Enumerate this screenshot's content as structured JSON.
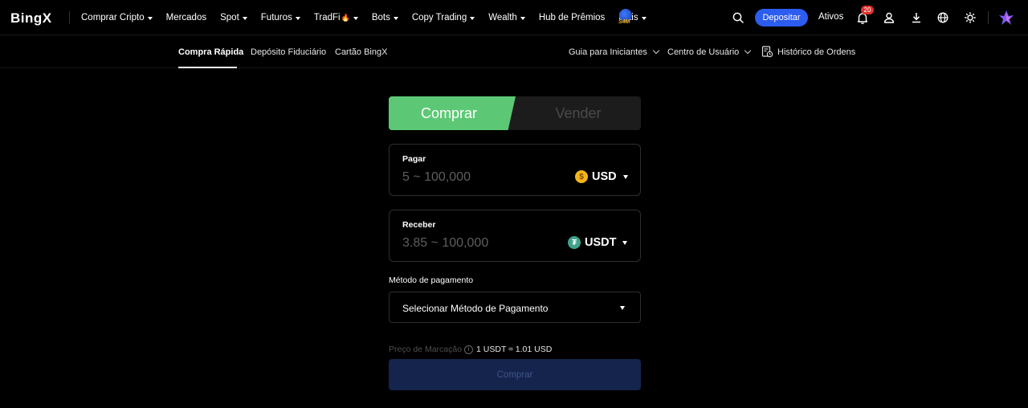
{
  "brand": {
    "logo_text": "BingX"
  },
  "nav": {
    "items": [
      {
        "label": "Comprar Cripto",
        "dropdown": true
      },
      {
        "label": "Mercados",
        "dropdown": false
      },
      {
        "label": "Spot",
        "dropdown": true
      },
      {
        "label": "Futuros",
        "dropdown": true
      },
      {
        "label": "TradFi",
        "dropdown": true,
        "emoji": "🔥"
      },
      {
        "label": "Bots",
        "dropdown": true
      },
      {
        "label": "Copy Trading",
        "dropdown": true
      },
      {
        "label": "Wealth",
        "dropdown": true
      },
      {
        "label": "Hub de Prêmios",
        "dropdown": false
      },
      {
        "label": "Mais",
        "dropdown": true
      }
    ],
    "promo_text": "S4M",
    "deposit_label": "Depositar",
    "assets_label": "Ativos",
    "notification_count": "20",
    "icons": [
      "search-icon",
      "bell-icon",
      "user-icon",
      "download-icon",
      "globe-icon",
      "sun-icon",
      "avatar"
    ]
  },
  "subnav": {
    "tabs": [
      {
        "label": "Compra Rápida",
        "active": true
      },
      {
        "label": "Depósito Fiduciário",
        "active": false
      },
      {
        "label": "Cartão BingX",
        "active": false
      }
    ],
    "guide_label": "Guia para Iniciantes",
    "user_center_label": "Centro de Usuário",
    "order_history_label": "Histórico de Ordens"
  },
  "trade": {
    "buy_label": "Comprar",
    "sell_label": "Vender",
    "pay": {
      "label": "Pagar",
      "placeholder": "5 ~ 100,000",
      "currency": "USD"
    },
    "receive": {
      "label": "Receber",
      "placeholder": "3.85 ~ 100,000",
      "currency": "USDT"
    },
    "payment_method_label": "Método de pagamento",
    "payment_method_placeholder": "Selecionar Método de Pagamento",
    "mark_price_label": "Preço de Marcação",
    "mark_price_value": "1 USDT ≈ 1.01 USD",
    "submit_label": "Comprar"
  },
  "colors": {
    "accent_blue": "#2c5cf0",
    "buy_green": "#5cc875",
    "disabled_button": "#15244d",
    "badge_red": "#e0322d"
  }
}
